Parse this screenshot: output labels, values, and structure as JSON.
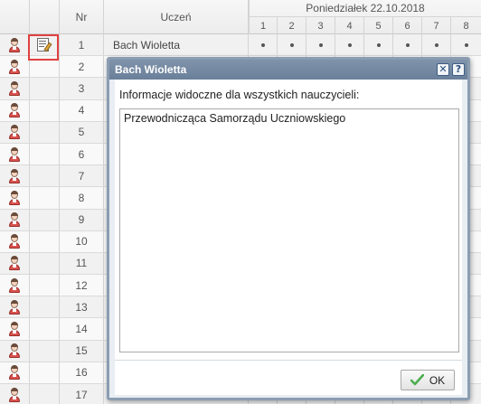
{
  "header": {
    "day": "Poniedziałek 22.10.2018",
    "nr_label": "Nr",
    "student_label": "Uczeń",
    "lessons": [
      "1",
      "2",
      "3",
      "4",
      "5",
      "6",
      "7",
      "8"
    ]
  },
  "rows": [
    {
      "nr": "1",
      "name": "Bach Wioletta",
      "lessons": [
        "•",
        "•",
        "•",
        "•",
        "•",
        "•",
        "•",
        "•"
      ]
    },
    {
      "nr": "2"
    },
    {
      "nr": "3"
    },
    {
      "nr": "4"
    },
    {
      "nr": "5"
    },
    {
      "nr": "6"
    },
    {
      "nr": "7"
    },
    {
      "nr": "8"
    },
    {
      "nr": "9"
    },
    {
      "nr": "10"
    },
    {
      "nr": "11"
    },
    {
      "nr": "12"
    },
    {
      "nr": "13"
    },
    {
      "nr": "14"
    },
    {
      "nr": "15"
    },
    {
      "nr": "16"
    },
    {
      "nr": "17"
    }
  ],
  "icons": {
    "student": "student-icon",
    "note": "note-edit-icon",
    "close": "close-icon",
    "help": "help-icon",
    "ok": "checkmark-icon"
  },
  "dialog": {
    "title": "Bach Wioletta",
    "close_glyph": "✕",
    "help_glyph": "?",
    "label": "Informacje widoczne dla wszystkich nauczycieli:",
    "text": "Przewodnicząca Samorządu Uczniowskiego",
    "ok_label": "OK"
  },
  "colors": {
    "dialog_title_bg": "#7389a3",
    "selection_border": "#e04040",
    "ok_check": "#4caf50"
  }
}
